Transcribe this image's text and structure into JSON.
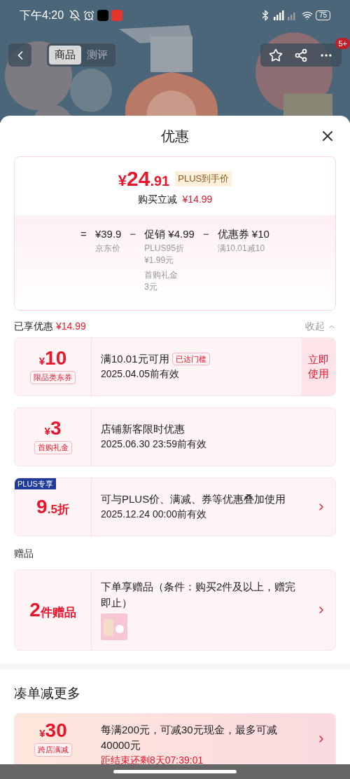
{
  "status_bar": {
    "time": "下午4:20",
    "battery": "75"
  },
  "nav": {
    "tabs": [
      {
        "label": "商品",
        "selected": true
      },
      {
        "label": "测评",
        "selected": false
      }
    ],
    "badge": "5+"
  },
  "sheet": {
    "title": "优惠",
    "summary": {
      "price_symbol": "¥",
      "price_int": "24",
      "price_dec": ".91",
      "price_tag": "PLUS到手价",
      "saving_label": "购买立减",
      "saving_value": "¥14.99",
      "breakdown": [
        {
          "operator": "=",
          "value": "¥39.9",
          "notes": [
            [
              "京东价"
            ]
          ]
        },
        {
          "operator": "−",
          "value": "促销 ¥4.99",
          "notes": [
            [
              "PLUS95折",
              "¥1.99元"
            ],
            [
              "首购礼金",
              "3元"
            ]
          ]
        },
        {
          "operator": "−",
          "value": "优惠券 ¥10",
          "notes": [
            [
              "满10.01减10"
            ]
          ]
        }
      ]
    },
    "enjoyed": {
      "label": "已享优惠",
      "value": "¥14.99",
      "toggle": "收起"
    },
    "coupons": [
      {
        "prefix": "¥",
        "main": "10",
        "tag": "限品类东券",
        "title": "满10.01元可用",
        "status": "已达门槛",
        "expiry": "2025.04.05前有效",
        "action": "立即使用"
      },
      {
        "prefix": "¥",
        "main": "3",
        "tag": "首购礼金",
        "title": "店铺新客限时优惠",
        "expiry": "2025.06.30 23:59前有效"
      },
      {
        "corner": "PLUS专享",
        "main": "9",
        "suffix": ".5折",
        "title": "可与PLUS价、满减、券等优惠叠加使用",
        "expiry": "2025.12.24 00:00前有效",
        "chevron": true
      }
    ],
    "gifts_label": "赠品",
    "gift": {
      "main": "2",
      "suffix": "件赠品",
      "title": "下单享赠品（条件：购买2件及以上，赠完即止）"
    },
    "more_title": "凑单减更多",
    "promo": {
      "prefix": "¥",
      "main": "30",
      "tag": "跨店满减",
      "title": "每满200元，可减30元现金，最多可减40000元",
      "countdown": "距结束还剩8天07:39:01"
    }
  }
}
